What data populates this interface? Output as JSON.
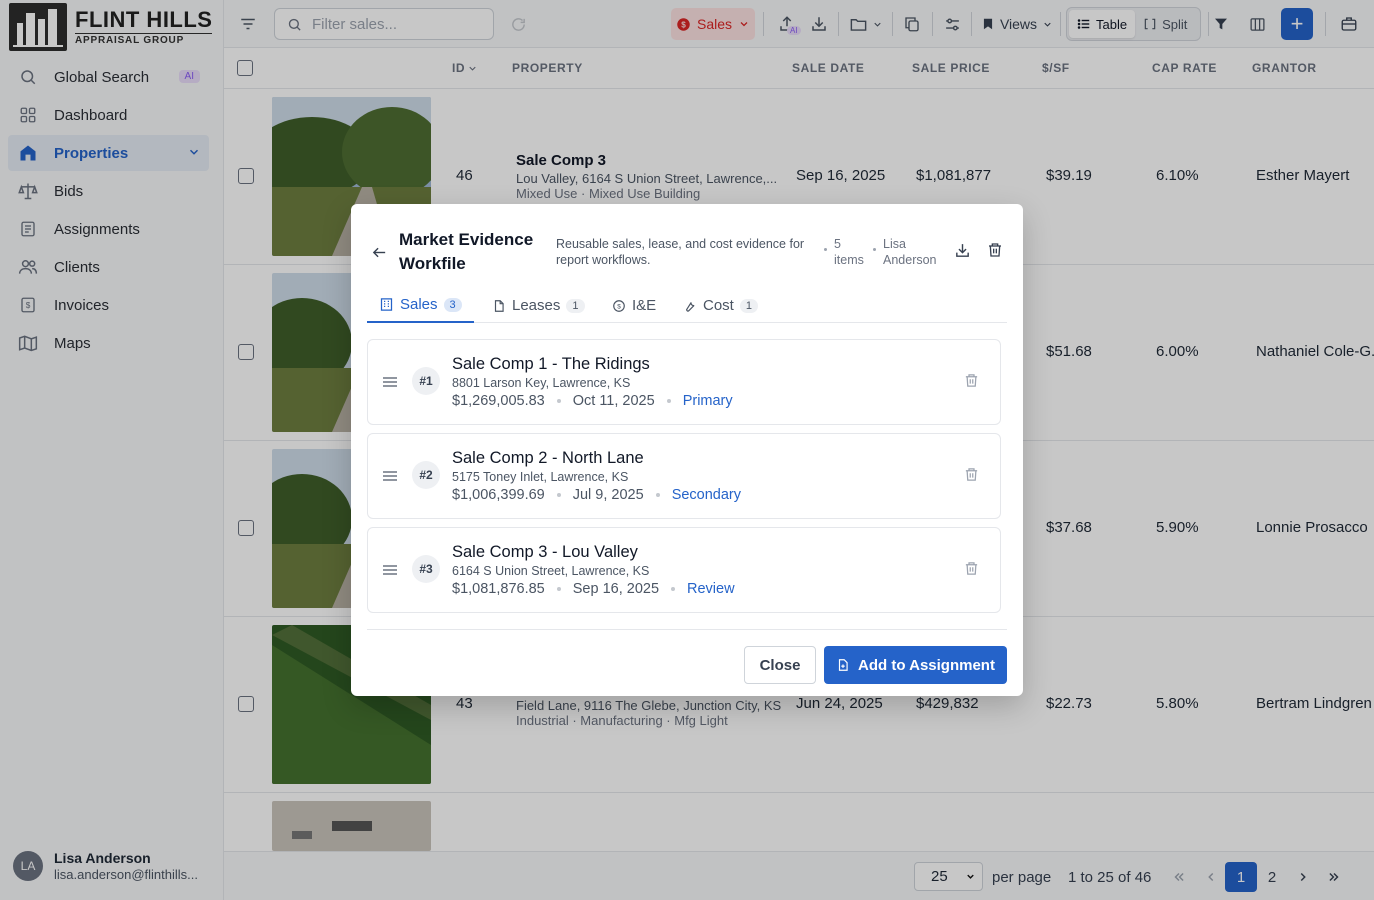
{
  "brand": {
    "name": "FLINT HILLS",
    "tagline": "APPRAISAL GROUP"
  },
  "sidebar": {
    "items": [
      {
        "label": "Global Search",
        "icon": "search-icon",
        "badge": "AI"
      },
      {
        "label": "Dashboard",
        "icon": "grid-icon"
      },
      {
        "label": "Properties",
        "icon": "home-icon",
        "active": true
      },
      {
        "label": "Bids",
        "icon": "scale-icon"
      },
      {
        "label": "Assignments",
        "icon": "clipboard-icon"
      },
      {
        "label": "Clients",
        "icon": "users-icon"
      },
      {
        "label": "Invoices",
        "icon": "receipt-icon"
      },
      {
        "label": "Maps",
        "icon": "map-icon"
      }
    ],
    "user": {
      "initials": "LA",
      "name": "Lisa Anderson",
      "email": "lisa.anderson@flinthills..."
    }
  },
  "toolbar": {
    "search_placeholder": "Filter sales...",
    "sales_label": "Sales",
    "ai_label": "AI",
    "views_label": "Views",
    "table_label": "Table",
    "split_label": "Split",
    "accent": "#2563c9"
  },
  "table": {
    "columns": [
      "ID",
      "PROPERTY",
      "SALE DATE",
      "SALE PRICE",
      "$/SF",
      "CAP RATE",
      "GRANTOR"
    ],
    "rows": [
      {
        "id": "46",
        "title": "Sale Comp 3",
        "address": "Lou Valley, 6164 S Union Street, Lawrence,...",
        "type": "Mixed Use · Mixed Use Building",
        "date": "Sep 16, 2025",
        "price": "$1,081,877",
        "psf": "$39.19",
        "cap": "6.10%",
        "grantor": "Esther Mayert"
      },
      {
        "id": "",
        "title": "",
        "address": "",
        "type": "",
        "date": "",
        "price": "",
        "psf": "$51.68",
        "cap": "6.00%",
        "grantor": "Nathaniel Cole-G..."
      },
      {
        "id": "",
        "title": "",
        "address": "",
        "type": "",
        "date": "",
        "price": "",
        "psf": "$37.68",
        "cap": "5.90%",
        "grantor": "Lonnie Prosacco"
      },
      {
        "id": "43",
        "title": "",
        "address": "Field Lane, 9116 The Glebe, Junction City, KS",
        "type": "Industrial · Manufacturing · Mfg Light",
        "date": "Jun 24, 2025",
        "price": "$429,832",
        "psf": "$22.73",
        "cap": "5.80%",
        "grantor": "Bertram Lindgren"
      }
    ]
  },
  "pager": {
    "per_page": "25",
    "per_page_label": "per page",
    "range": "1 to 25 of 46",
    "pages": [
      "1",
      "2"
    ]
  },
  "modal": {
    "title": "Market Evidence Workfile",
    "description": "Reusable sales, lease, and cost evidence for report workflows.",
    "items": "5 items",
    "owner": "Lisa Anderson",
    "tabs": [
      {
        "label": "Sales",
        "count": "3"
      },
      {
        "label": "Leases",
        "count": "1"
      },
      {
        "label": "I&E",
        "count": ""
      },
      {
        "label": "Cost",
        "count": "1"
      }
    ],
    "comps": [
      {
        "num": "#1",
        "title": "Sale Comp 1 - The Ridings",
        "address": "8801 Larson Key, Lawrence, KS",
        "price": "$1,269,005.83",
        "date": "Oct 11, 2025",
        "tag": "Primary"
      },
      {
        "num": "#2",
        "title": "Sale Comp 2 - North Lane",
        "address": "5175 Toney Inlet, Lawrence, KS",
        "price": "$1,006,399.69",
        "date": "Jul 9, 2025",
        "tag": "Secondary"
      },
      {
        "num": "#3",
        "title": "Sale Comp 3 - Lou Valley",
        "address": "6164 S Union Street, Lawrence, KS",
        "price": "$1,081,876.85",
        "date": "Sep 16, 2025",
        "tag": "Review"
      }
    ],
    "close_label": "Close",
    "add_label": "Add to Assignment"
  }
}
